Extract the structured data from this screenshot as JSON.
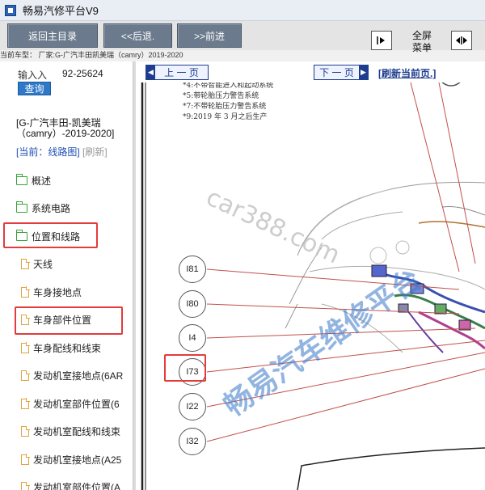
{
  "window": {
    "title": "畅易汽修平台V9"
  },
  "toolbar": {
    "back_main": "返回主目录",
    "back": "<<后退.",
    "forward": ">>前进",
    "fullscreen_line1": "全屏",
    "fullscreen_line2": "菜单"
  },
  "current_car": "当前车型： 厂家:G-广汽丰田凯美瑞（camry）2019-2020",
  "search": {
    "label": "输入入",
    "code": "92-25624",
    "query_button": "查询"
  },
  "model": {
    "text": "[G-广汽丰田-凯美瑞（camry）-2019-2020]",
    "current_label": "[当前：线路图]",
    "refresh_label": "[刷新]"
  },
  "tree": {
    "items": [
      {
        "label": "概述",
        "type": "folder"
      },
      {
        "label": "系统电路",
        "type": "folder"
      },
      {
        "label": "位置和线路",
        "type": "folder",
        "open": true,
        "highlighted": true
      },
      {
        "label": "天线",
        "type": "doc"
      },
      {
        "label": "车身接地点",
        "type": "doc"
      },
      {
        "label": "车身部件位置",
        "type": "doc",
        "highlighted": true
      },
      {
        "label": "车身配线和线束",
        "type": "doc"
      },
      {
        "label": "发动机室接地点(6AR",
        "type": "doc"
      },
      {
        "label": "发动机室部件位置(6",
        "type": "doc"
      },
      {
        "label": "发动机室配线和线束",
        "type": "doc"
      },
      {
        "label": "发动机室接地点(A25",
        "type": "doc"
      },
      {
        "label": "发动机室部件位置(A",
        "type": "doc"
      }
    ]
  },
  "diagram_nav": {
    "prev": "上 一 页",
    "next": "下 一 页",
    "refresh": "[刷新当前页.]"
  },
  "diagram": {
    "notes": [
      "*4:不带智能进入和起动系统",
      "*5:带轮胎压力警告系统",
      "*7:不带轮胎压力警告系统",
      "*9:2019 年 3 月之后生产"
    ],
    "watermark_site": "car388.com",
    "watermark_cn": "畅易汽车维修平台",
    "connectors": [
      "I81",
      "I80",
      "I4",
      "I73",
      "I22",
      "I32"
    ],
    "highlighted_connector": "I73"
  },
  "colors": {
    "toolbar_button": "#6b7a8c",
    "query_button": "#2e78c8",
    "highlight": "#e23c3c",
    "nav_blue": "#1e3d8f",
    "folder_green": "#38a23a",
    "doc_orange": "#e2a23c"
  }
}
